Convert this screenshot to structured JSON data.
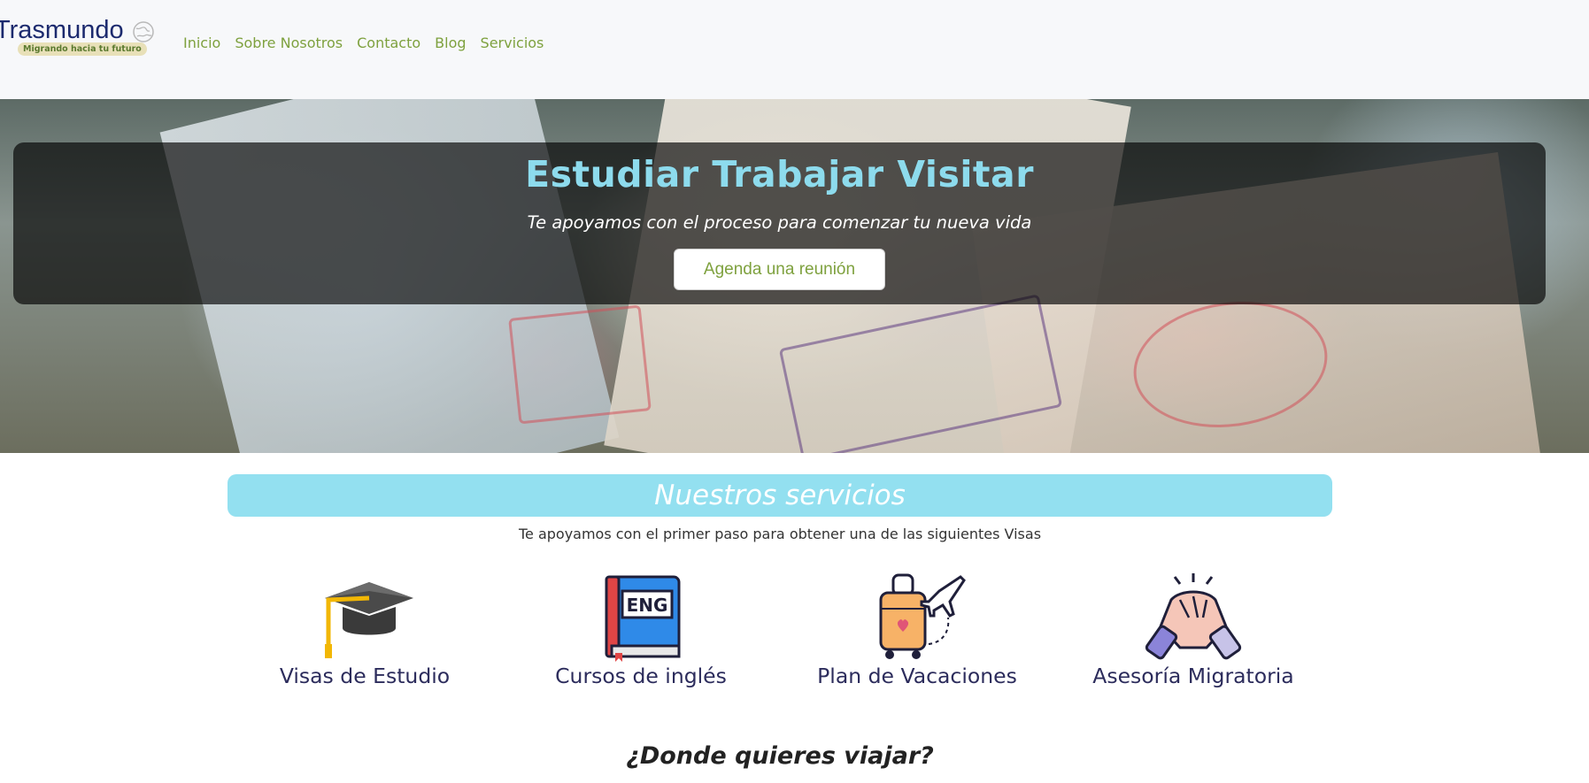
{
  "brand": {
    "name": "Trasmundo",
    "tagline": "Migrando hacia tu futuro"
  },
  "nav": {
    "links": [
      {
        "label": "Inicio"
      },
      {
        "label": "Sobre Nosotros"
      },
      {
        "label": "Contacto"
      },
      {
        "label": "Blog"
      },
      {
        "label": "Servicios"
      }
    ],
    "link_color": "#7ea13e"
  },
  "hero": {
    "title": "Estudiar Trabajar Visitar",
    "subtitle": "Te apoyamos con el proceso para comenzar tu nueva vida",
    "cta_label": "Agenda una reunión",
    "title_color": "#8ddbed"
  },
  "services": {
    "heading": "Nuestros servicios",
    "subtitle": "Te apoyamos con el primer paso para obtener una de las siguientes Visas",
    "banner_color": "#93e0f0",
    "items": [
      {
        "label": "Visas de Estudio",
        "icon": "graduation-cap-icon"
      },
      {
        "label": "Cursos de inglés",
        "icon": "english-book-icon"
      },
      {
        "label": "Plan de Vacaciones",
        "icon": "luggage-plane-icon"
      },
      {
        "label": "Asesoría Migratoria",
        "icon": "handshake-icon"
      }
    ]
  },
  "destinations": {
    "heading": "¿Donde quieres viajar?"
  }
}
